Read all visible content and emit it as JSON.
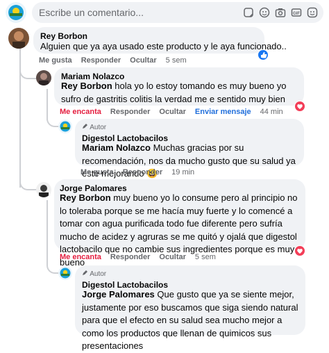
{
  "composer": {
    "placeholder": "Escribe un comentario..."
  },
  "actions": {
    "like": "Me gusta",
    "reply": "Responder",
    "hide": "Ocultar",
    "loved": "Me encanta",
    "send": "Enviar mensaje"
  },
  "author_badge": "Autor",
  "comments": [
    {
      "name": "Rey Borbon",
      "text": "Alguien que ya aya usado este producto y le aya funcionado..",
      "time": "5 sem"
    },
    {
      "name": "Mariam Nolazco",
      "mention": "Rey Borbon",
      "text": " hola yo lo estoy tomando es muy bueno yo sufro de gastritis colitis la verdad me e sentido muy bien",
      "time": "44 min"
    },
    {
      "name": "Digestol Lactobacilos",
      "mention": "Mariam Nolazco",
      "text": " Muchas gracias por su recomendación, nos da mucho gusto que su salud ya este mejorando 😀",
      "time": "19 min"
    },
    {
      "name": "Jorge Palomares",
      "mention": "Rey Borbon",
      "text": " muy bueno yo lo consume pero al principio no lo toleraba porque se me hacía muy fuerte y lo comencé a tomar con agua purificada todo fue diferente pero sufría mucho de acidez y agruras se me quitó y ojalá que digestol lactobacilo que no cambie sus ingredientes porque es muy bueno",
      "time": "5 sem"
    },
    {
      "name": "Digestol Lactobacilos",
      "mention": "Jorge Palomares",
      "text": " Que gusto que ya se siente mejor, justamente por eso buscamos que siga siendo natural para que el efecto en su salud sea mucho mejor a como los productos que llenan de quimicos sus presentaciones",
      "time": ""
    }
  ]
}
